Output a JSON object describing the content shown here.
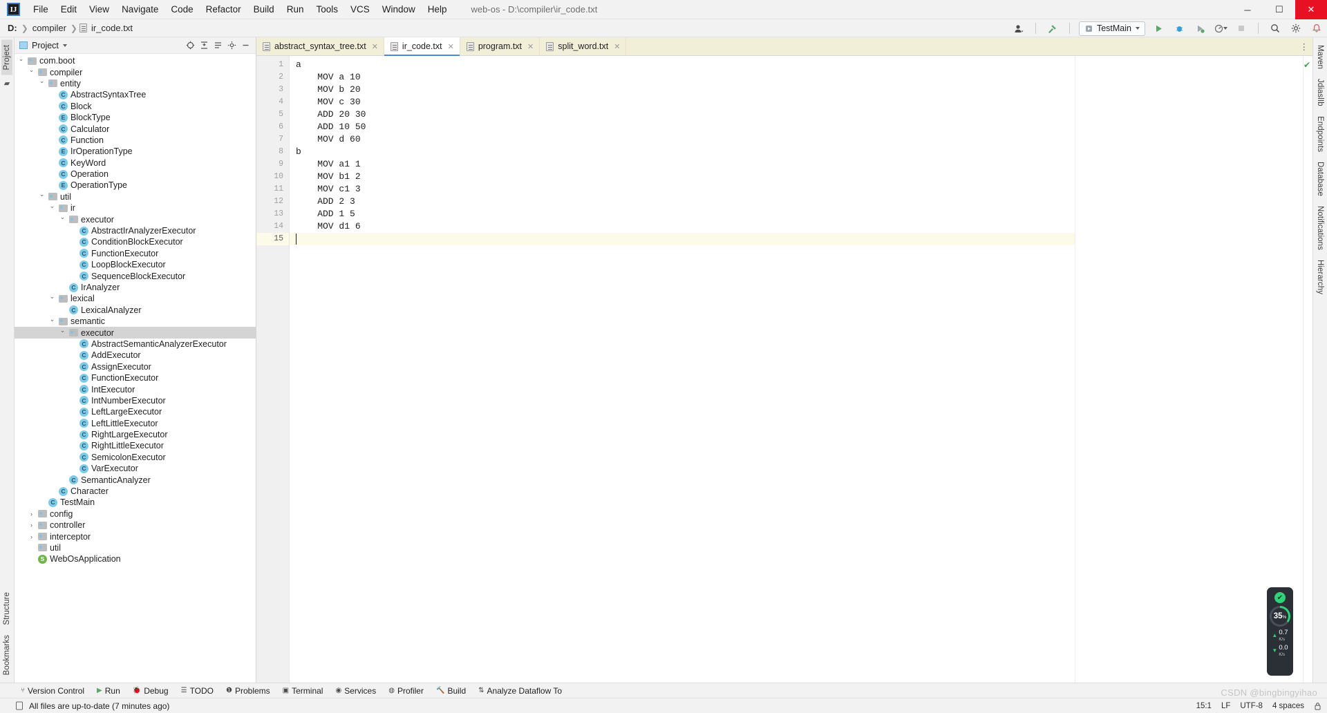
{
  "window": {
    "title": "web-os - D:\\compiler\\ir_code.txt",
    "logo": "IJ",
    "minimize": "─",
    "maximize": "☐",
    "close": "✕"
  },
  "menu": [
    {
      "label": "File"
    },
    {
      "label": "Edit"
    },
    {
      "label": "View"
    },
    {
      "label": "Navigate"
    },
    {
      "label": "Code"
    },
    {
      "label": "Refactor"
    },
    {
      "label": "Build"
    },
    {
      "label": "Run"
    },
    {
      "label": "Tools"
    },
    {
      "label": "VCS"
    },
    {
      "label": "Window"
    },
    {
      "label": "Help"
    }
  ],
  "breadcrumb": {
    "items": [
      "D:",
      "compiler",
      "ir_code.txt"
    ],
    "separator": "❯"
  },
  "toolbar": {
    "run_config": "TestMain",
    "icons": [
      "user-icon",
      "hammer-build-icon",
      "run-icon",
      "debug-icon",
      "run-with-coverage-icon",
      "profile-icon",
      "stop-icon",
      "search-everywhere-icon",
      "settings-icon",
      "notifications-icon"
    ]
  },
  "left_strip": {
    "tabs": [
      "Project",
      "Bookmarks",
      "Structure"
    ]
  },
  "right_strip": {
    "tabs": [
      "Maven",
      "JdiaslIb",
      "Endpoints",
      "Database",
      "Notifications",
      "Hierarchy"
    ]
  },
  "project_panel": {
    "title": "Project",
    "header_icons": [
      "locate-icon",
      "collapse-all-icon",
      "expand-icon",
      "settings-icon",
      "hide-icon"
    ],
    "tree": [
      {
        "depth": 3,
        "chev": "open",
        "icon": "folder",
        "label": "com.boot"
      },
      {
        "depth": 4,
        "chev": "open",
        "icon": "folder",
        "label": "compiler"
      },
      {
        "depth": 5,
        "chev": "open",
        "icon": "folder",
        "label": "entity"
      },
      {
        "depth": 6,
        "chev": "none",
        "icon": "C",
        "label": "AbstractSyntaxTree"
      },
      {
        "depth": 6,
        "chev": "none",
        "icon": "C",
        "label": "Block"
      },
      {
        "depth": 6,
        "chev": "none",
        "icon": "E",
        "label": "BlockType"
      },
      {
        "depth": 6,
        "chev": "none",
        "icon": "C",
        "label": "Calculator"
      },
      {
        "depth": 6,
        "chev": "none",
        "icon": "C",
        "label": "Function"
      },
      {
        "depth": 6,
        "chev": "none",
        "icon": "E",
        "label": "IrOperationType"
      },
      {
        "depth": 6,
        "chev": "none",
        "icon": "C",
        "label": "KeyWord"
      },
      {
        "depth": 6,
        "chev": "none",
        "icon": "C",
        "label": "Operation"
      },
      {
        "depth": 6,
        "chev": "none",
        "icon": "E",
        "label": "OperationType"
      },
      {
        "depth": 5,
        "chev": "open",
        "icon": "folder",
        "label": "util"
      },
      {
        "depth": 6,
        "chev": "open",
        "icon": "folder",
        "label": "ir"
      },
      {
        "depth": 7,
        "chev": "open",
        "icon": "folder",
        "label": "executor"
      },
      {
        "depth": 8,
        "chev": "none",
        "icon": "C",
        "label": "AbstractIrAnalyzerExecutor"
      },
      {
        "depth": 8,
        "chev": "none",
        "icon": "C",
        "label": "ConditionBlockExecutor"
      },
      {
        "depth": 8,
        "chev": "none",
        "icon": "C",
        "label": "FunctionExecutor"
      },
      {
        "depth": 8,
        "chev": "none",
        "icon": "C",
        "label": "LoopBlockExecutor"
      },
      {
        "depth": 8,
        "chev": "none",
        "icon": "C",
        "label": "SequenceBlockExecutor"
      },
      {
        "depth": 7,
        "chev": "none",
        "icon": "C",
        "label": "IrAnalyzer"
      },
      {
        "depth": 6,
        "chev": "open",
        "icon": "folder",
        "label": "lexical"
      },
      {
        "depth": 7,
        "chev": "none",
        "icon": "C",
        "label": "LexicalAnalyzer"
      },
      {
        "depth": 6,
        "chev": "open",
        "icon": "folder",
        "label": "semantic"
      },
      {
        "depth": 7,
        "chev": "open",
        "icon": "folder",
        "label": "executor",
        "selected": true
      },
      {
        "depth": 8,
        "chev": "none",
        "icon": "C",
        "label": "AbstractSemanticAnalyzerExecutor"
      },
      {
        "depth": 8,
        "chev": "none",
        "icon": "C",
        "label": "AddExecutor"
      },
      {
        "depth": 8,
        "chev": "none",
        "icon": "C",
        "label": "AssignExecutor"
      },
      {
        "depth": 8,
        "chev": "none",
        "icon": "C",
        "label": "FunctionExecutor"
      },
      {
        "depth": 8,
        "chev": "none",
        "icon": "C",
        "label": "IntExecutor"
      },
      {
        "depth": 8,
        "chev": "none",
        "icon": "C",
        "label": "IntNumberExecutor"
      },
      {
        "depth": 8,
        "chev": "none",
        "icon": "C",
        "label": "LeftLargeExecutor"
      },
      {
        "depth": 8,
        "chev": "none",
        "icon": "C",
        "label": "LeftLittleExecutor"
      },
      {
        "depth": 8,
        "chev": "none",
        "icon": "C",
        "label": "RightLargeExecutor"
      },
      {
        "depth": 8,
        "chev": "none",
        "icon": "C",
        "label": "RightLittleExecutor"
      },
      {
        "depth": 8,
        "chev": "none",
        "icon": "C",
        "label": "SemicolonExecutor"
      },
      {
        "depth": 8,
        "chev": "none",
        "icon": "C",
        "label": "VarExecutor"
      },
      {
        "depth": 7,
        "chev": "none",
        "icon": "C",
        "label": "SemanticAnalyzer"
      },
      {
        "depth": 6,
        "chev": "none",
        "icon": "C",
        "label": "Character"
      },
      {
        "depth": 5,
        "chev": "none",
        "icon": "C",
        "label": "TestMain"
      },
      {
        "depth": 4,
        "chev": "closed",
        "icon": "folder",
        "label": "config"
      },
      {
        "depth": 4,
        "chev": "closed",
        "icon": "folder",
        "label": "controller"
      },
      {
        "depth": 4,
        "chev": "closed",
        "icon": "folder",
        "label": "interceptor"
      },
      {
        "depth": 4,
        "chev": "none",
        "icon": "folder",
        "label": "util"
      },
      {
        "depth": 4,
        "chev": "none",
        "icon": "S",
        "label": "WebOsApplication"
      }
    ]
  },
  "editor": {
    "tabs": [
      {
        "label": "abstract_syntax_tree.txt",
        "active": false
      },
      {
        "label": "ir_code.txt",
        "active": true
      },
      {
        "label": "program.txt",
        "active": false
      },
      {
        "label": "split_word.txt",
        "active": false
      }
    ],
    "lines": [
      {
        "no": "1",
        "text": "a"
      },
      {
        "no": "2",
        "text": "    MOV a 10"
      },
      {
        "no": "3",
        "text": "    MOV b 20"
      },
      {
        "no": "4",
        "text": "    MOV c 30"
      },
      {
        "no": "5",
        "text": "    ADD 20 30"
      },
      {
        "no": "6",
        "text": "    ADD 10 50"
      },
      {
        "no": "7",
        "text": "    MOV d 60"
      },
      {
        "no": "8",
        "text": "b"
      },
      {
        "no": "9",
        "text": "    MOV a1 1"
      },
      {
        "no": "10",
        "text": "    MOV b1 2"
      },
      {
        "no": "11",
        "text": "    MOV c1 3"
      },
      {
        "no": "12",
        "text": "    ADD 2 3"
      },
      {
        "no": "13",
        "text": "    ADD 1 5"
      },
      {
        "no": "14",
        "text": "    MOV d1 6"
      },
      {
        "no": "15",
        "text": "",
        "current": true
      }
    ]
  },
  "hud": {
    "status_icon": "check",
    "percent": "35",
    "percent_unit": "%",
    "up_value": "0.7",
    "up_unit": "K/s",
    "down_value": "0.0",
    "down_unit": "K/s"
  },
  "tool_windows": [
    {
      "label": "Version Control",
      "icon": "branch-icon"
    },
    {
      "label": "Run",
      "icon": "run-icon"
    },
    {
      "label": "Debug",
      "icon": "debug-icon"
    },
    {
      "label": "TODO",
      "icon": "list-icon"
    },
    {
      "label": "Problems",
      "icon": "problems-icon"
    },
    {
      "label": "Terminal",
      "icon": "terminal-icon"
    },
    {
      "label": "Services",
      "icon": "services-icon"
    },
    {
      "label": "Profiler",
      "icon": "profiler-icon"
    },
    {
      "label": "Build",
      "icon": "hammer-icon"
    },
    {
      "label": "Analyze Dataflow To",
      "icon": "dataflow-icon"
    }
  ],
  "statusbar": {
    "message": "All files are up-to-date (7 minutes ago)",
    "caret": "15:1",
    "line_sep": "LF",
    "encoding": "UTF-8",
    "indent": "4 spaces",
    "watermark": "CSDN @bingbingyihao"
  },
  "colors": {
    "accent": "#4a89d6",
    "tab_bg": "#f2efd8",
    "class_icon": "#7ecbe8",
    "ok_green": "#3fa14a",
    "hud_green": "#2fd27a"
  }
}
